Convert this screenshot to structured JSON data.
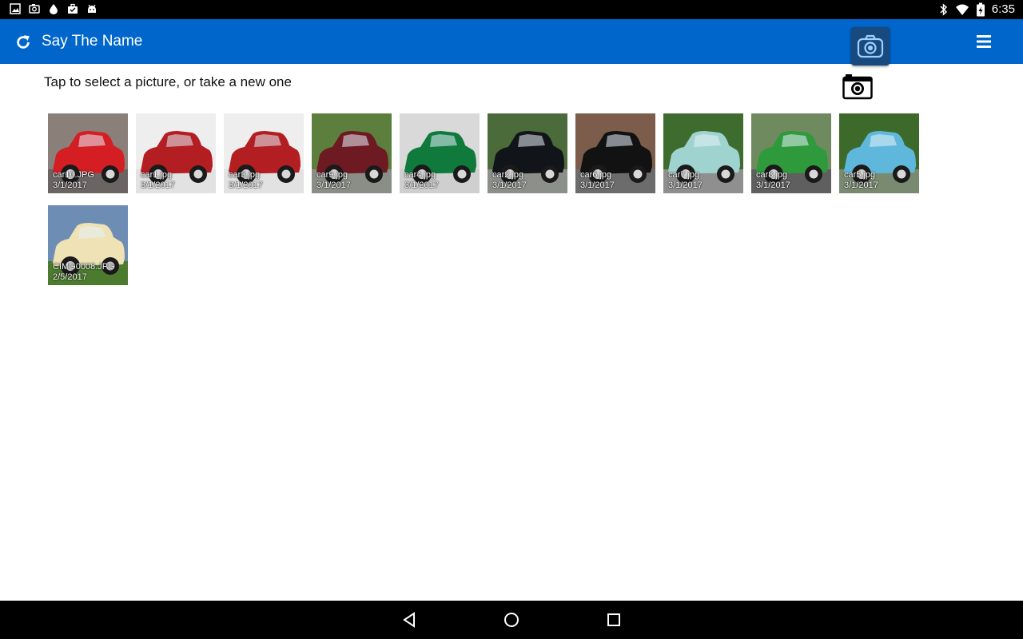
{
  "status_bar": {
    "time": "6:35",
    "left_icons": [
      "image-icon",
      "camera-icon",
      "drop-icon",
      "briefcase-icon",
      "android-icon"
    ],
    "right_icons": [
      "bluetooth-icon",
      "wifi-icon",
      "battery-icon"
    ]
  },
  "app_bar": {
    "title": "Say The Name",
    "left_icon": "refresh-icon",
    "action_icon": "camera-icon",
    "menu_icon": "menu-icon"
  },
  "prompt": "Tap to select a picture, or take a new one",
  "pictures": [
    {
      "name": "car10.JPG",
      "date": "3/1/2017",
      "body": "#d41e24",
      "bg": "#8a7f79",
      "ground": "#6a6463"
    },
    {
      "name": "car1.jpg",
      "date": "3/1/2017",
      "body": "#b31e22",
      "bg": "#eeeeee",
      "ground": "#e2e2e2"
    },
    {
      "name": "car3.jpg",
      "date": "3/1/2017",
      "body": "#b31e22",
      "bg": "#eeeeee",
      "ground": "#e2e2e2"
    },
    {
      "name": "car9.jpg",
      "date": "3/1/2017",
      "body": "#6e1a22",
      "bg": "#5d7f3e",
      "ground": "#8b8e86"
    },
    {
      "name": "car4.jpg",
      "date": "3/1/2017",
      "body": "#0f7a3c",
      "bg": "#d9d9d9",
      "ground": "#cfcfcf"
    },
    {
      "name": "car2.jpg",
      "date": "3/1/2017",
      "body": "#111418",
      "bg": "#4b6b3a",
      "ground": "#8d8f8b"
    },
    {
      "name": "car6.jpg",
      "date": "3/1/2017",
      "body": "#121212",
      "bg": "#7c5d4b",
      "ground": "#6c6c6c"
    },
    {
      "name": "car7.jpg",
      "date": "3/1/2017",
      "body": "#9fd3cf",
      "bg": "#3e6b2e",
      "ground": "#8f8f8f"
    },
    {
      "name": "car8.jpg",
      "date": "3/1/2017",
      "body": "#2e9a3c",
      "bg": "#6f8a5e",
      "ground": "#5f5f5f"
    },
    {
      "name": "car5.jpg",
      "date": "3/1/2017",
      "body": "#5fb8dc",
      "bg": "#3d6a2b",
      "ground": "#7a8a70"
    },
    {
      "name": "CIMG0008.JPG",
      "date": "2/5/2017",
      "body": "#efe2b4",
      "bg": "#6e8db5",
      "ground": "#4c7b2e"
    }
  ],
  "nav_bar": {
    "icons": [
      "back-icon",
      "home-icon",
      "recents-icon"
    ]
  },
  "colors": {
    "app_bar": "#0066cc",
    "camera_button": "#174a7e",
    "status_bar": "#000000",
    "nav_bar": "#000000"
  }
}
